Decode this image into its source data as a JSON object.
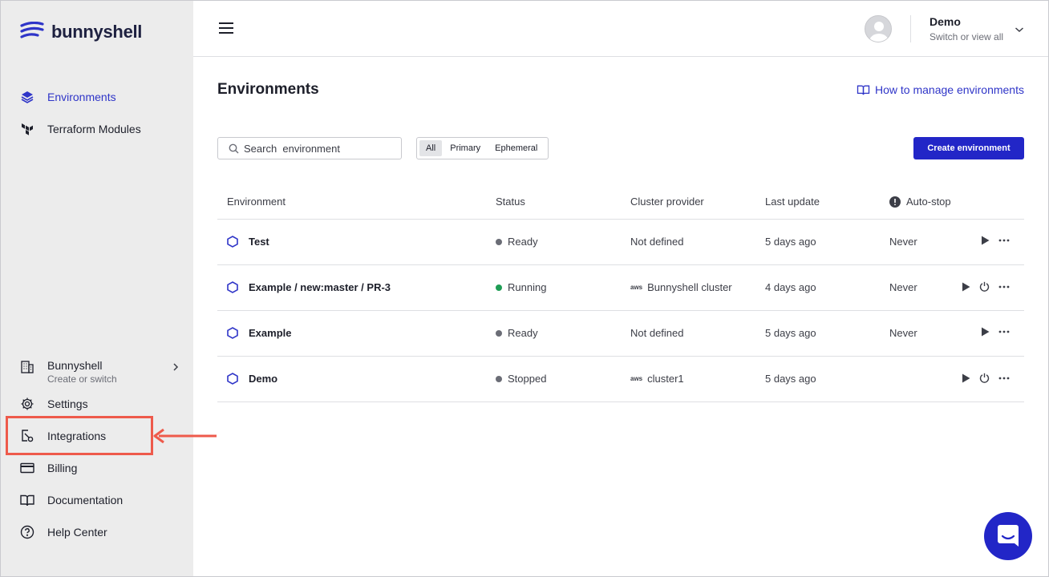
{
  "brand": {
    "name": "bunnyshell"
  },
  "sidebar": {
    "top_items": [
      {
        "label": "Environments",
        "icon": "layers-icon",
        "active": true
      },
      {
        "label": "Terraform Modules",
        "icon": "terraform-icon",
        "active": false
      }
    ],
    "org": {
      "title": "Bunnyshell",
      "subtitle": "Create or switch"
    },
    "bottom_items": [
      {
        "label": "Settings",
        "icon": "gear-icon"
      },
      {
        "label": "Integrations",
        "icon": "integrations-icon"
      },
      {
        "label": "Billing",
        "icon": "credit-card-icon"
      },
      {
        "label": "Documentation",
        "icon": "book-icon"
      },
      {
        "label": "Help Center",
        "icon": "question-icon"
      }
    ]
  },
  "topbar": {
    "user": {
      "name": "Demo",
      "subtitle": "Switch or view all"
    }
  },
  "main": {
    "title": "Environments",
    "help_link": "How to manage environments",
    "search": {
      "placeholder": "Search  environment",
      "value": ""
    },
    "filters": [
      {
        "label": "All",
        "selected": true
      },
      {
        "label": "Primary",
        "selected": false
      },
      {
        "label": "Ephemeral",
        "selected": false
      }
    ],
    "create_label": "Create environment"
  },
  "table": {
    "columns": [
      "Environment",
      "Status",
      "Cluster provider",
      "Last update",
      "Auto-stop"
    ],
    "rows": [
      {
        "name": "Test",
        "status": "Ready",
        "cluster": "Not defined",
        "aws": false,
        "updated": "5 days ago",
        "autostop": "Never",
        "power": false
      },
      {
        "name": "Example / new:master / PR-3",
        "status": "Running",
        "cluster": "Bunnyshell cluster",
        "aws": true,
        "updated": "4 days ago",
        "autostop": "Never",
        "power": true
      },
      {
        "name": "Example",
        "status": "Ready",
        "cluster": "Not defined",
        "aws": false,
        "updated": "5 days ago",
        "autostop": "Never",
        "power": false
      },
      {
        "name": "Demo",
        "status": "Stopped",
        "cluster": "cluster1",
        "aws": true,
        "updated": "5 days ago",
        "autostop": "",
        "power": true
      }
    ]
  },
  "aws_label": "aws",
  "colors": {
    "accent": "#2226c7",
    "link": "#2f35c8",
    "highlight": "#ee5a4b",
    "status_ready": "#6b6d76",
    "status_running": "#1f9d55",
    "status_stopped": "#6b6d76"
  }
}
